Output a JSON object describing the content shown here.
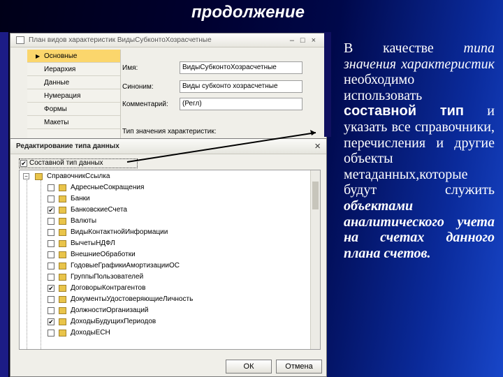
{
  "slide": {
    "title": "продолжение"
  },
  "back_window": {
    "title": "План видов характеристик ВидыСубконтоХозрасчетные",
    "controls": "–□×",
    "nav_items": [
      "Основные",
      "Иерархия",
      "Данные",
      "Нумерация",
      "Формы",
      "Макеты"
    ],
    "active_nav": 0,
    "fields": {
      "name_label": "Имя:",
      "name_value": "ВидыСубконтоХозрасчетные",
      "synonym_label": "Синоним:",
      "synonym_value": "Виды субконто хозрасчетные",
      "comment_label": "Комментарий:",
      "comment_value": "(Регл)",
      "type_label": "Тип значения характеристик:"
    }
  },
  "dialog": {
    "title": "Редактирование типа данных",
    "close_glyph": "×",
    "composite_label": "Составной тип данных",
    "composite_checked": "✔",
    "root": "СправочникСсылка",
    "expand_glyph": "−",
    "items": [
      {
        "label": "АдресныеСокращения",
        "checked": ""
      },
      {
        "label": "Банки",
        "checked": ""
      },
      {
        "label": "БанковскиеСчета",
        "checked": "✔"
      },
      {
        "label": "Валюты",
        "checked": ""
      },
      {
        "label": "ВидыКонтактнойИнформации",
        "checked": ""
      },
      {
        "label": "ВычетыНДФЛ",
        "checked": ""
      },
      {
        "label": "ВнешниеОбработки",
        "checked": ""
      },
      {
        "label": "ГодовыеГрафикиАмортизацииОС",
        "checked": ""
      },
      {
        "label": "ГруппыПользователей",
        "checked": ""
      },
      {
        "label": "ДоговорыКонтрагентов",
        "checked": "✔"
      },
      {
        "label": "ДокументыУдостоверяющиеЛичность",
        "checked": ""
      },
      {
        "label": "ДолжностиОрганизаций",
        "checked": ""
      },
      {
        "label": "ДоходыБудущихПериодов",
        "checked": "✔"
      },
      {
        "label": "ДоходыЕСН",
        "checked": ""
      }
    ],
    "ok_label": "ОК",
    "cancel_label": "Отмена"
  },
  "description": {
    "p1": "В качестве ",
    "p2": "типа значения характеристик",
    "p3": " необходимо использовать ",
    "p4": "составной тип",
    "p5": " и указать все справочники, перечисления и другие объекты метаданных,которые будут служить ",
    "p6": "объектами аналитического учета на счетах данного плана счетов."
  },
  "colors": {
    "accent": "#fbd66c",
    "text": "#ffffff"
  }
}
